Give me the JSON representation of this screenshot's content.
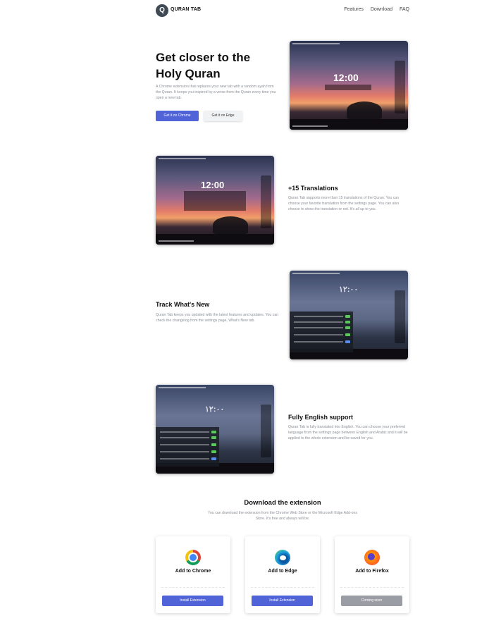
{
  "header": {
    "logo_letter": "Q",
    "brand": "QURAN TAB",
    "nav": [
      "Features",
      "Download",
      "FAQ"
    ]
  },
  "hero": {
    "title": "Get closer to the Holy Quran",
    "description": "A Chrome extension that replaces your new tab with a random ayah from the Quran. It keeps you inspired by a verse from the Quran every time you open a new tab.",
    "btn_chrome": "Get it on Chrome",
    "btn_edge": "Get it on Edge"
  },
  "screens": {
    "s1_clock": "12:00",
    "s2_clock": "12:00",
    "s3_clock": "١٢:٠٠",
    "s4_clock": "١٢:٠٠"
  },
  "features": [
    {
      "title": "+15 Translations",
      "description": "Quran Tab supports more than 15 translations of the Quran. You can choose your favorite translation from the settings page. You can also choose to show the translation or not. It's all up to you."
    },
    {
      "title": "Track What's New",
      "description": "Quran Tab keeps you updated with the latest features and updates. You can check the changelog from the settings page, What's New tab."
    },
    {
      "title": "Fully English support",
      "description": "Quran Tab is fully translated into English. You can choose your preferred language from the settings page between English and Arabic and it will be applied to the whole extension and be saved for you."
    }
  ],
  "download": {
    "title": "Download the extension",
    "description": "You can download the extension from the Chrome Web Store or the Microsoft Edge Add-ons Store. It's free and always will be.",
    "cards": [
      {
        "icon": "chrome-icon",
        "label": "Add to Chrome",
        "button": "Install Extension",
        "button_color": "#5064d8"
      },
      {
        "icon": "edge-icon",
        "label": "Add to Edge",
        "button": "Install Extension",
        "button_color": "#5064d8"
      },
      {
        "icon": "firefox-icon",
        "label": "Add to Firefox",
        "button": "Coming soon",
        "button_color": "#9a9da3"
      }
    ]
  },
  "colors": {
    "accent": "#5064d8",
    "muted_text": "#8a8f96",
    "disabled": "#9a9da3"
  }
}
